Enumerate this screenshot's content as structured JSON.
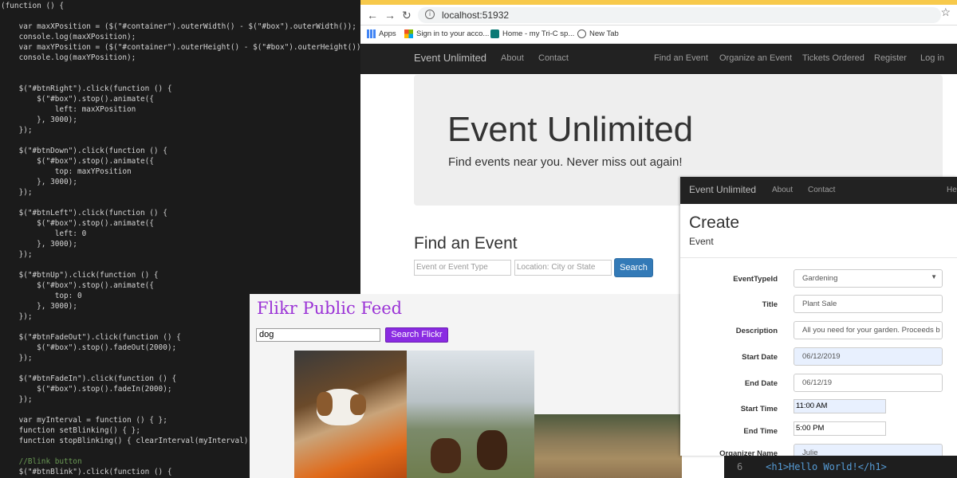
{
  "editor": {
    "lines": [
      "(function () {",
      "",
      "    var maxXPosition = ($(\"#container\").outerWidth() - $(\"#box\").outerWidth());",
      "    console.log(maxXPosition);",
      "    var maxYPosition = ($(\"#container\").outerHeight() - $(\"#box\").outerHeight());",
      "    console.log(maxYPosition);",
      "",
      "",
      "    $(\"#btnRight\").click(function () {",
      "        $(\"#box\").stop().animate({",
      "            left: maxXPosition",
      "        }, 3000);",
      "    });",
      "",
      "    $(\"#btnDown\").click(function () {",
      "        $(\"#box\").stop().animate({",
      "            top: maxYPosition",
      "        }, 3000);",
      "    });",
      "",
      "    $(\"#btnLeft\").click(function () {",
      "        $(\"#box\").stop().animate({",
      "            left: 0",
      "        }, 3000);",
      "    });",
      "",
      "    $(\"#btnUp\").click(function () {",
      "        $(\"#box\").stop().animate({",
      "            top: 0",
      "        }, 3000);",
      "    });",
      "",
      "    $(\"#btnFadeOut\").click(function () {",
      "        $(\"#box\").stop().fadeOut(2000);",
      "    });",
      "",
      "    $(\"#btnFadeIn\").click(function () {",
      "        $(\"#box\").stop().fadeIn(2000);",
      "    });",
      "",
      "    var myInterval = function () { };",
      "    function setBlinking() { };",
      "    function stopBlinking() { clearInterval(myInterval) };",
      "",
      "    //Blink button",
      "    $(\"#btnBlink\").click(function () {"
    ]
  },
  "browser": {
    "url": "localhost:51932",
    "bookmarks": [
      "Apps",
      "Sign in to your acco...",
      "Home - my Tri-C sp...",
      "New Tab"
    ],
    "nav": {
      "brand": "Event Unlimited",
      "left": [
        "About",
        "Contact"
      ],
      "right": [
        "Find an Event",
        "Organize an Event",
        "Tickets Ordered",
        "Register",
        "Log in"
      ]
    },
    "jumbotron": {
      "title": "Event Unlimited",
      "subtitle": "Find events near you. Never miss out again!"
    },
    "find": {
      "heading": "Find an Event",
      "type_placeholder": "Event or Event Type",
      "location_placeholder": "Location: City or State",
      "button": "Search"
    }
  },
  "flickr": {
    "title": "Flikr Public Feed",
    "query": "dog",
    "button": "Search Flickr"
  },
  "create": {
    "nav": {
      "brand": "Event Unlimited",
      "items": [
        "About",
        "Contact",
        "He"
      ]
    },
    "heading": "Create",
    "subheading": "Event",
    "fields": [
      {
        "label": "EventTypeId",
        "value": "Gardening"
      },
      {
        "label": "Title",
        "value": "Plant Sale"
      },
      {
        "label": "Description",
        "value": "All you need for your garden. Proceeds b"
      },
      {
        "label": "Start Date",
        "value": "06/12/2019"
      },
      {
        "label": "End Date",
        "value": "06/12/19"
      },
      {
        "label": "Start Time",
        "value": "11:00 AM"
      },
      {
        "label": "End Time",
        "value": "5:00 PM"
      },
      {
        "label": "Organizer Name",
        "value": "Julie"
      }
    ]
  },
  "snippet": {
    "line_number": "6",
    "code": "<h1>Hello World!</h1>"
  },
  "colors": {
    "primary_button": "#337ab7",
    "flickr_purple": "#8a2be2",
    "navbar": "#222222",
    "jumbotron": "#eeeeee"
  }
}
